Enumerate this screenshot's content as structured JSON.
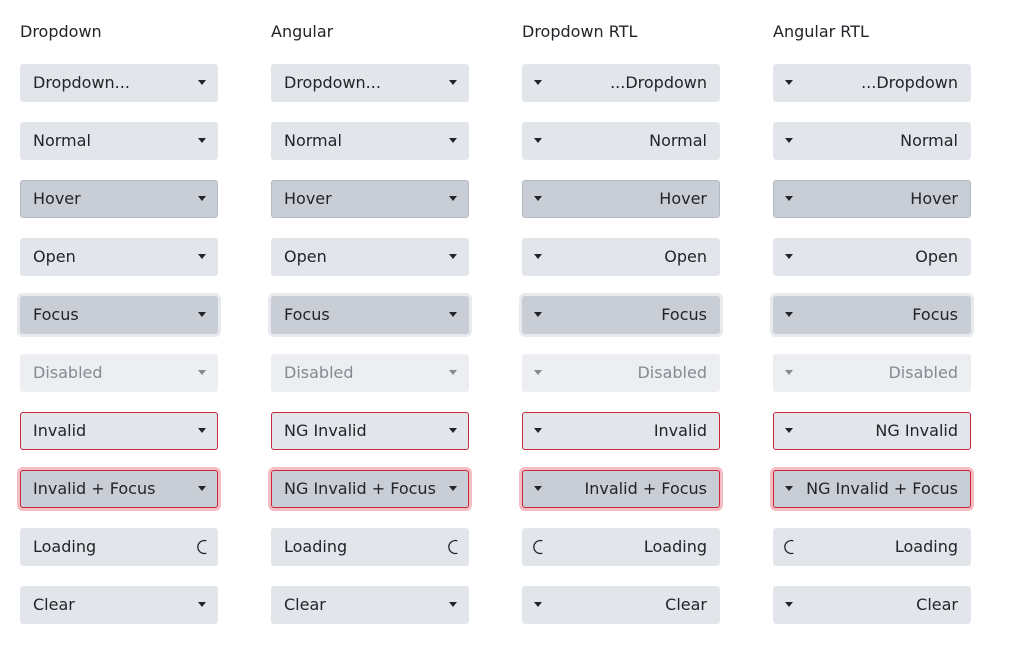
{
  "columns": [
    {
      "title": "Dropdown",
      "rtl": false,
      "rows": [
        {
          "label": "Dropdown...",
          "state": "normal",
          "icon": "caret-down"
        },
        {
          "label": "Normal",
          "state": "normal",
          "icon": "caret-down"
        },
        {
          "label": "Hover",
          "state": "hover",
          "icon": "caret-down"
        },
        {
          "label": "Open",
          "state": "normal",
          "icon": "caret-down"
        },
        {
          "label": "Focus",
          "state": "focus",
          "icon": "caret-down"
        },
        {
          "label": "Disabled",
          "state": "disabled",
          "icon": "caret-down"
        },
        {
          "label": "Invalid",
          "state": "invalid",
          "icon": "caret-down"
        },
        {
          "label": "Invalid + Focus",
          "state": "invalid-focus",
          "icon": "caret-down"
        },
        {
          "label": "Loading",
          "state": "normal",
          "icon": "spinner"
        },
        {
          "label": "Clear",
          "state": "normal",
          "icon": "caret-down"
        }
      ]
    },
    {
      "title": "Angular",
      "rtl": false,
      "rows": [
        {
          "label": "Dropdown...",
          "state": "normal",
          "icon": "caret-down"
        },
        {
          "label": "Normal",
          "state": "normal",
          "icon": "caret-down"
        },
        {
          "label": "Hover",
          "state": "hover",
          "icon": "caret-down"
        },
        {
          "label": "Open",
          "state": "normal",
          "icon": "caret-down"
        },
        {
          "label": "Focus",
          "state": "focus",
          "icon": "caret-down"
        },
        {
          "label": "Disabled",
          "state": "disabled",
          "icon": "caret-down"
        },
        {
          "label": "NG Invalid",
          "state": "invalid",
          "icon": "caret-down"
        },
        {
          "label": "NG Invalid + Focus",
          "state": "invalid-focus",
          "icon": "caret-down"
        },
        {
          "label": "Loading",
          "state": "normal",
          "icon": "spinner"
        },
        {
          "label": "Clear",
          "state": "normal",
          "icon": "caret-down"
        }
      ]
    },
    {
      "title": "Dropdown RTL",
      "rtl": true,
      "rows": [
        {
          "label": "...Dropdown",
          "state": "normal",
          "icon": "caret-down"
        },
        {
          "label": "Normal",
          "state": "normal",
          "icon": "caret-down"
        },
        {
          "label": "Hover",
          "state": "hover",
          "icon": "caret-down"
        },
        {
          "label": "Open",
          "state": "normal",
          "icon": "caret-down"
        },
        {
          "label": "Focus",
          "state": "focus",
          "icon": "caret-down"
        },
        {
          "label": "Disabled",
          "state": "disabled",
          "icon": "caret-down"
        },
        {
          "label": "Invalid",
          "state": "invalid",
          "icon": "caret-down"
        },
        {
          "label": "Invalid + Focus",
          "state": "invalid-focus",
          "icon": "caret-down"
        },
        {
          "label": "Loading",
          "state": "normal",
          "icon": "spinner"
        },
        {
          "label": "Clear",
          "state": "normal",
          "icon": "caret-down"
        }
      ]
    },
    {
      "title": "Angular RTL",
      "rtl": true,
      "rows": [
        {
          "label": "...Dropdown",
          "state": "normal",
          "icon": "caret-down"
        },
        {
          "label": "Normal",
          "state": "normal",
          "icon": "caret-down"
        },
        {
          "label": "Hover",
          "state": "hover",
          "icon": "caret-down"
        },
        {
          "label": "Open",
          "state": "normal",
          "icon": "caret-down"
        },
        {
          "label": "Focus",
          "state": "focus",
          "icon": "caret-down"
        },
        {
          "label": "Disabled",
          "state": "disabled",
          "icon": "caret-down"
        },
        {
          "label": "NG Invalid",
          "state": "invalid",
          "icon": "caret-down"
        },
        {
          "label": "NG Invalid + Focus",
          "state": "invalid-focus",
          "icon": "caret-down"
        },
        {
          "label": "Loading",
          "state": "normal",
          "icon": "spinner"
        },
        {
          "label": "Clear",
          "state": "normal",
          "icon": "caret-down"
        }
      ]
    }
  ],
  "colors": {
    "background": "#e2e5ea",
    "hover_background": "#c9ced6",
    "disabled_background": "#eceef1",
    "invalid_border": "#c8283c",
    "invalid_focus_ring": "#f3bdc3",
    "text": "#212529",
    "disabled_text": "#858a92"
  }
}
